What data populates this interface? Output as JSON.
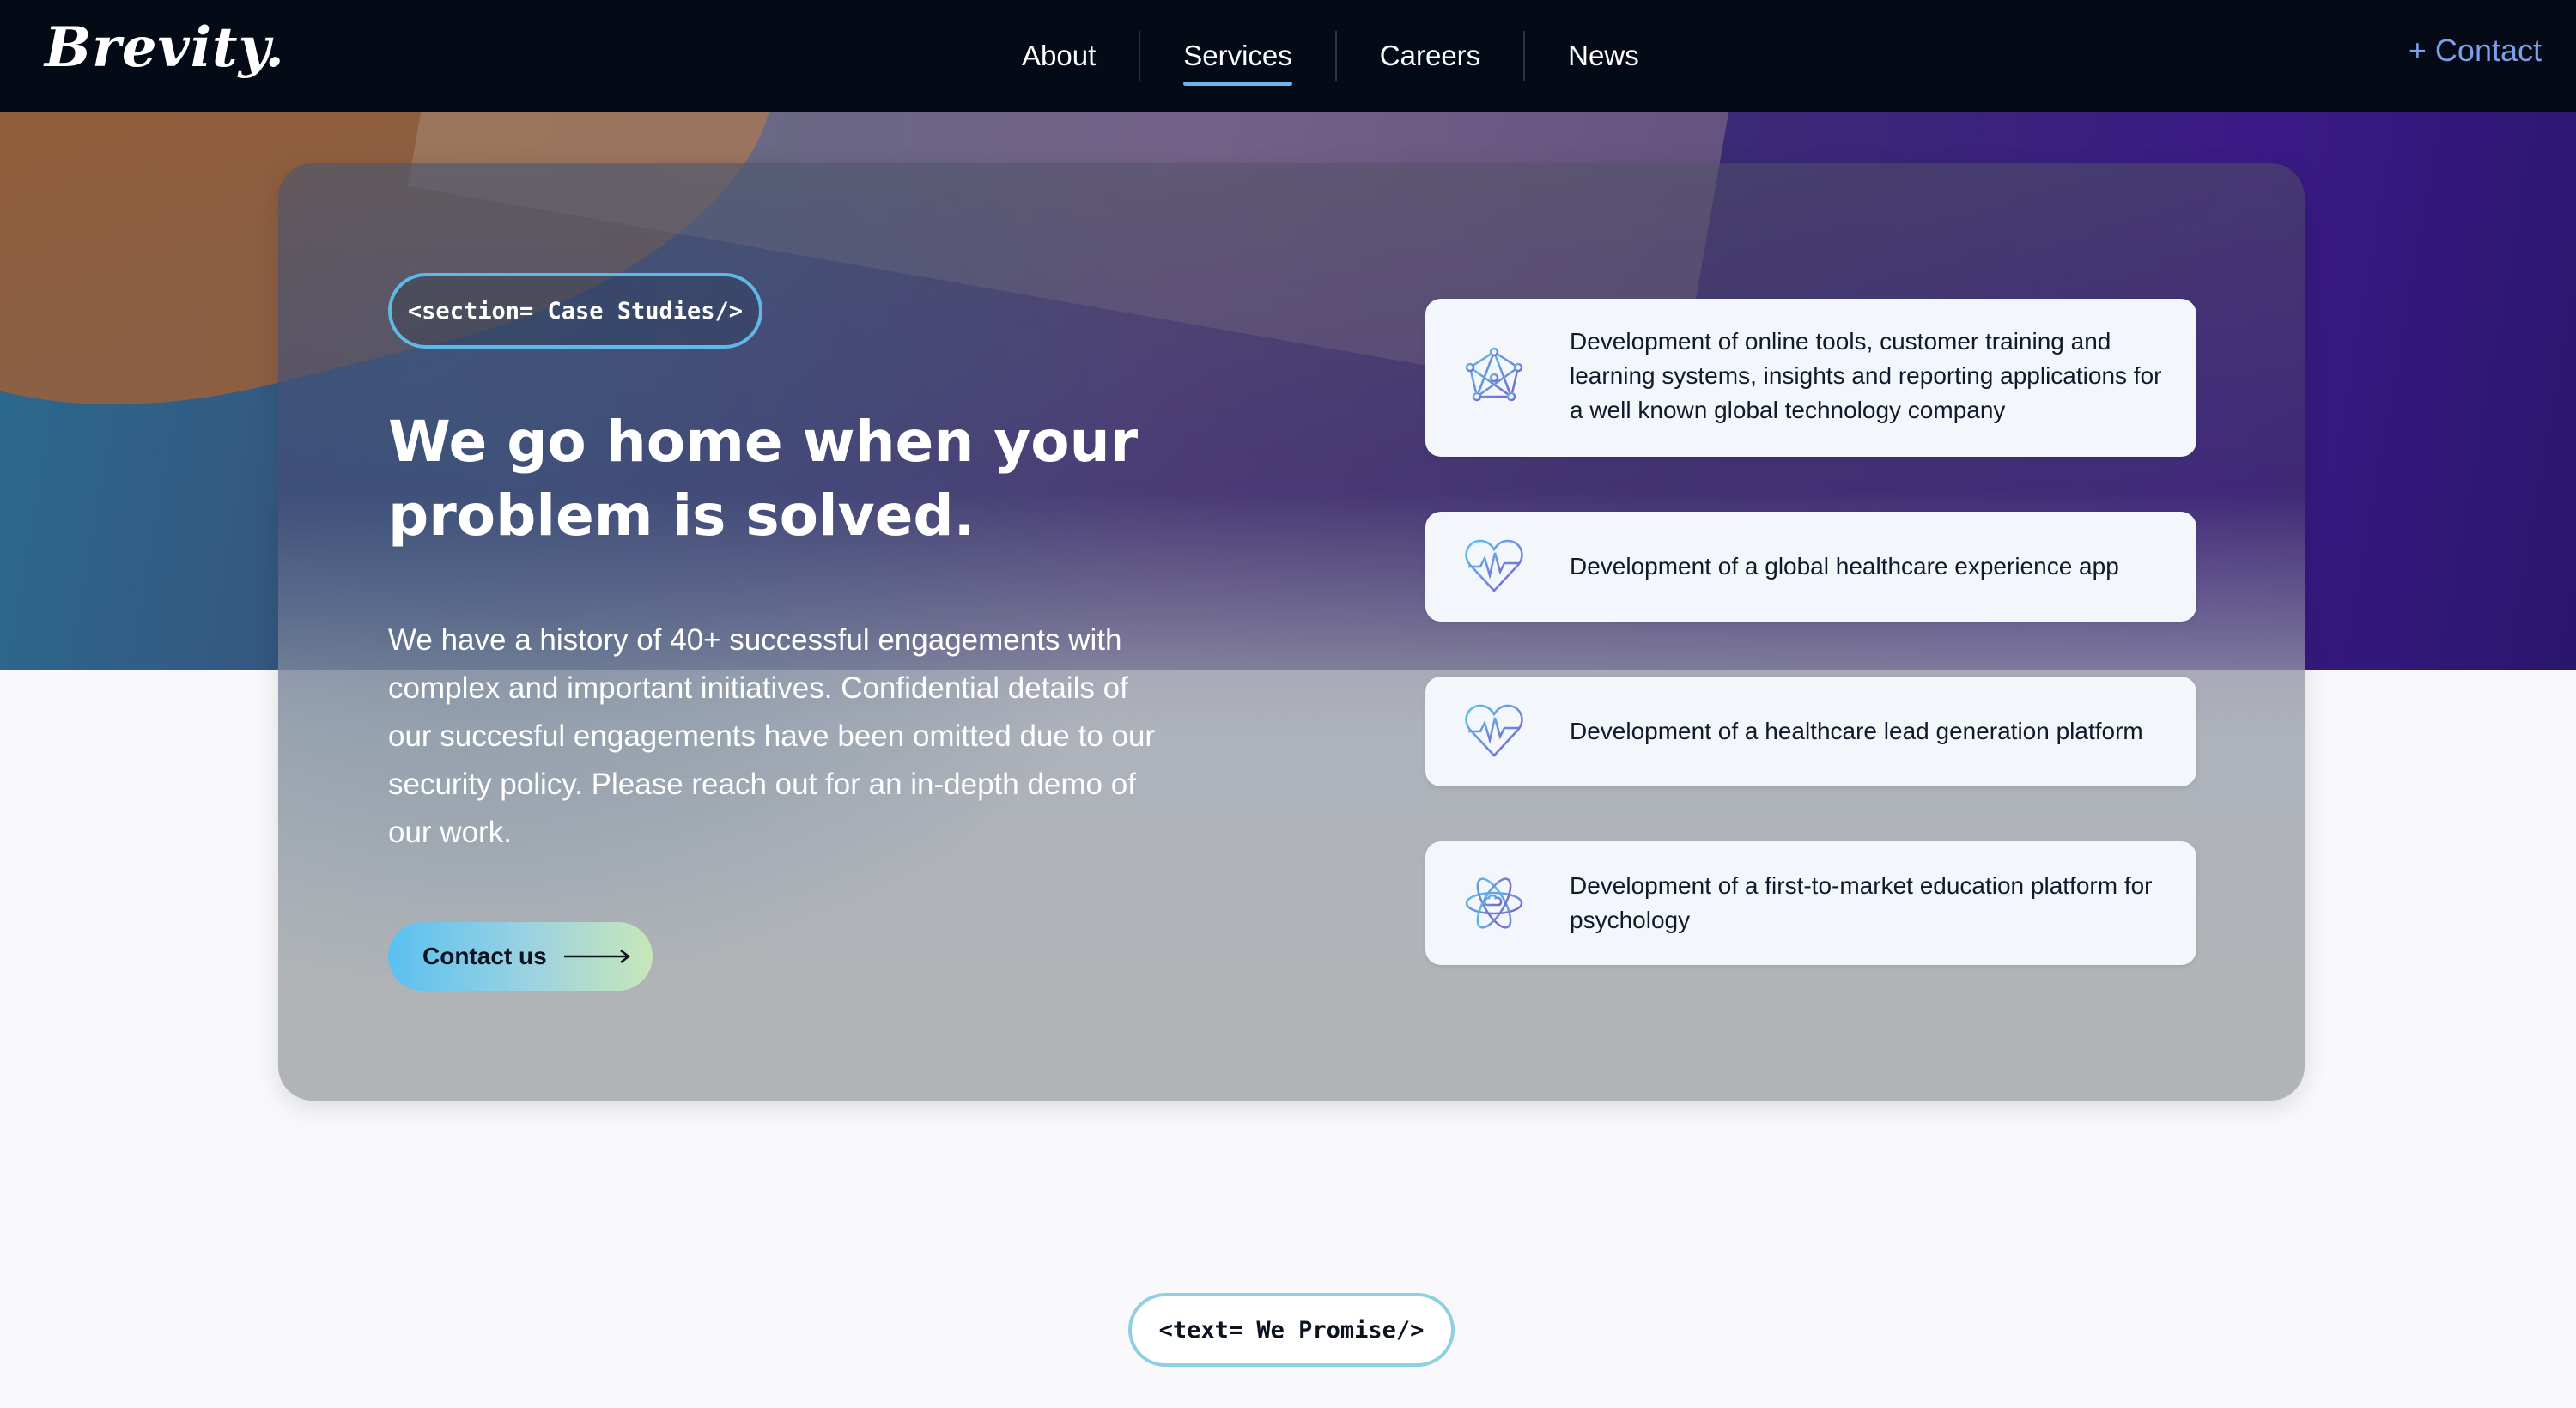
{
  "nav": {
    "logo": "Brevity.",
    "links": [
      "About",
      "Services",
      "Careers",
      "News"
    ],
    "active_index": 1,
    "contact": "+ Contact"
  },
  "hero": {
    "tag": "<section= Case Studies/>",
    "headline_line1": "We go home when your",
    "headline_line2": "problem is solved.",
    "body": "We have a history of 40+ successful engagements with complex and important initiatives. Confidential details of our succesful engagements have been omitted due to our security policy. Please reach out for an in-depth demo of our work.",
    "cta_label": "Contact us"
  },
  "cases": [
    {
      "icon": "network-icon",
      "text": "Development of online tools, customer training and learning systems, insights and reporting applications for a well known global technology company"
    },
    {
      "icon": "heartbeat-icon",
      "text": "Development of a global healthcare experience app"
    },
    {
      "icon": "heartbeat-icon",
      "text": "Development of a healthcare lead generation platform"
    },
    {
      "icon": "atom-brain-icon",
      "text": "Development of a first-to-market education platform for psychology"
    }
  ],
  "promise_tag": "<text= We Promise/>",
  "colors": {
    "nav_bg": "#040b17",
    "contact_link": "#7b9fe8",
    "tag_border": "#5fb8e8",
    "card_item_bg": "#f3f6fa"
  }
}
